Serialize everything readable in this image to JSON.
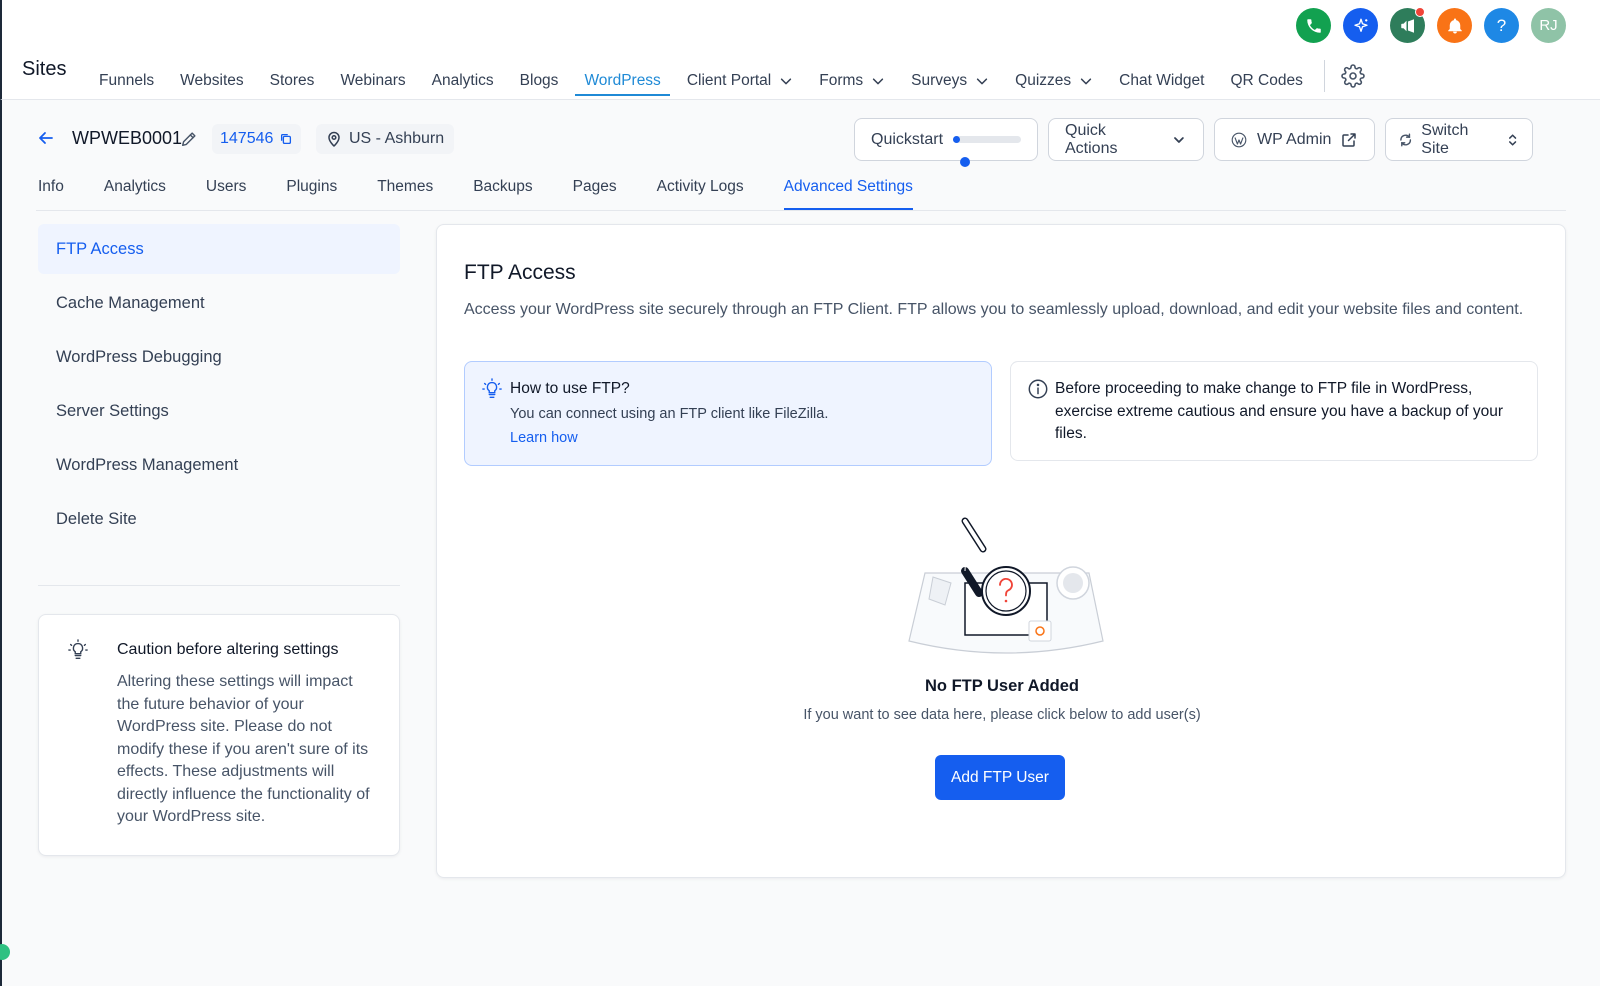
{
  "brand": "Sites",
  "nav": {
    "items": [
      {
        "label": "Funnels"
      },
      {
        "label": "Websites"
      },
      {
        "label": "Stores"
      },
      {
        "label": "Webinars"
      },
      {
        "label": "Analytics"
      },
      {
        "label": "Blogs"
      },
      {
        "label": "WordPress",
        "active": true
      },
      {
        "label": "Client Portal",
        "dropdown": true
      },
      {
        "label": "Forms",
        "dropdown": true
      },
      {
        "label": "Surveys",
        "dropdown": true
      },
      {
        "label": "Quizzes",
        "dropdown": true
      },
      {
        "label": "Chat Widget"
      },
      {
        "label": "QR Codes"
      }
    ]
  },
  "header_actions": {
    "phone_color": "#12a150",
    "ai_color": "#155eef",
    "announce_color": "#2e7d5b",
    "bell_color": "#f97316",
    "help_color": "#1e88e5",
    "avatar_initials": "RJ",
    "avatar_color": "#8fc3a7"
  },
  "site": {
    "name": "WPWEB0001",
    "id": "147546",
    "location": "US - Ashburn"
  },
  "toolbar": {
    "quickstart_label": "Quickstart",
    "quickstart_progress": 0.1,
    "quick_actions_label": "Quick Actions",
    "wp_admin_label": "WP Admin",
    "switch_site_label": "Switch Site"
  },
  "tabs": [
    "Info",
    "Analytics",
    "Users",
    "Plugins",
    "Themes",
    "Backups",
    "Pages",
    "Activity Logs",
    "Advanced Settings"
  ],
  "active_tab": "Advanced Settings",
  "sidebar": {
    "items": [
      "FTP Access",
      "Cache Management",
      "WordPress Debugging",
      "Server Settings",
      "WordPress Management",
      "Delete Site"
    ],
    "active": "FTP Access"
  },
  "caution": {
    "title": "Caution before altering settings",
    "body": "Altering these settings will impact the future behavior of your WordPress site. Please do not modify these if you aren't sure of its effects. These adjustments will directly influence the functionality of your WordPress site."
  },
  "main": {
    "title": "FTP Access",
    "description": "Access your WordPress site securely through an FTP Client. FTP allows you to seamlessly upload, download, and edit your website files and content.",
    "info": {
      "title": "How to use FTP?",
      "body": "You can connect using an FTP client like FileZilla.",
      "link": "Learn how"
    },
    "warning": "Before proceeding to make change to FTP file in WordPress, exercise extreme cautious and ensure you have a backup of your files.",
    "empty": {
      "title": "No FTP User Added",
      "subtitle": "If you want to see data here, please click below to add user(s)",
      "button": "Add FTP User"
    }
  }
}
